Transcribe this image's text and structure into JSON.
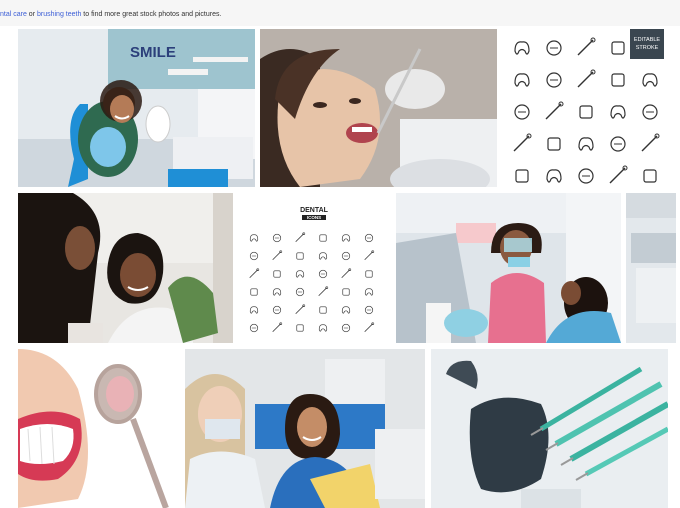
{
  "search_hint": {
    "link1": "ntal care",
    "mid": " or ",
    "link2": "brushing teeth",
    "rest": " to find more great stock photos and pictures."
  },
  "tiles": [
    {
      "name": "photo-woman-dental-chair"
    },
    {
      "name": "photo-dentist-mirror-exam"
    },
    {
      "name": "illustration-dental-icon-grid",
      "badge_line1": "EDITABLE",
      "badge_line2": "STROKE"
    },
    {
      "name": "photo-patient-dentist-talk"
    },
    {
      "name": "illustration-dental-icons-sheet",
      "title": "DENTAL",
      "subtitle": "ICONS"
    },
    {
      "name": "photo-dentist-child-checkup"
    },
    {
      "name": "photo-dental-clinic-partial"
    },
    {
      "name": "photo-smile-mirror-closeup"
    },
    {
      "name": "photo-woman-dental-checkup"
    },
    {
      "name": "photo-dental-drill-tools"
    }
  ],
  "colors": {
    "accent_link": "#3d5fd6",
    "badge_bg": "#3a4650",
    "chair_blue": "#1f8fd6",
    "scrub_pink": "#e7708f"
  }
}
